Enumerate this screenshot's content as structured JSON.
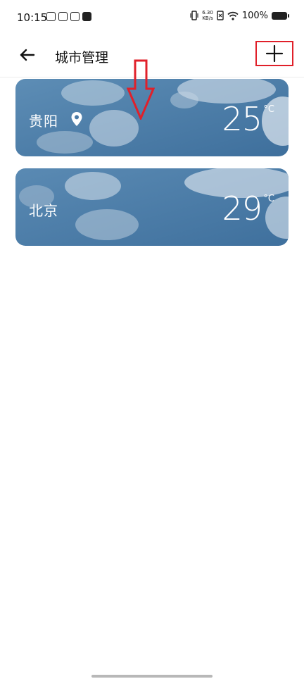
{
  "status_bar": {
    "time": "10:15",
    "net_speed_value": "6.30",
    "net_speed_unit": "KB/s",
    "battery_percent": "100%"
  },
  "header": {
    "title": "城市管理",
    "back_icon": "arrow-left-icon",
    "add_icon": "plus-icon"
  },
  "cities": [
    {
      "name": "贵阳",
      "temperature": "25",
      "unit": "°C",
      "is_current_location": true
    },
    {
      "name": "北京",
      "temperature": "29",
      "unit": "°C",
      "is_current_location": false
    }
  ],
  "colors": {
    "sky_blue": "#4a7aa6",
    "annotation_red": "#e0202a"
  }
}
